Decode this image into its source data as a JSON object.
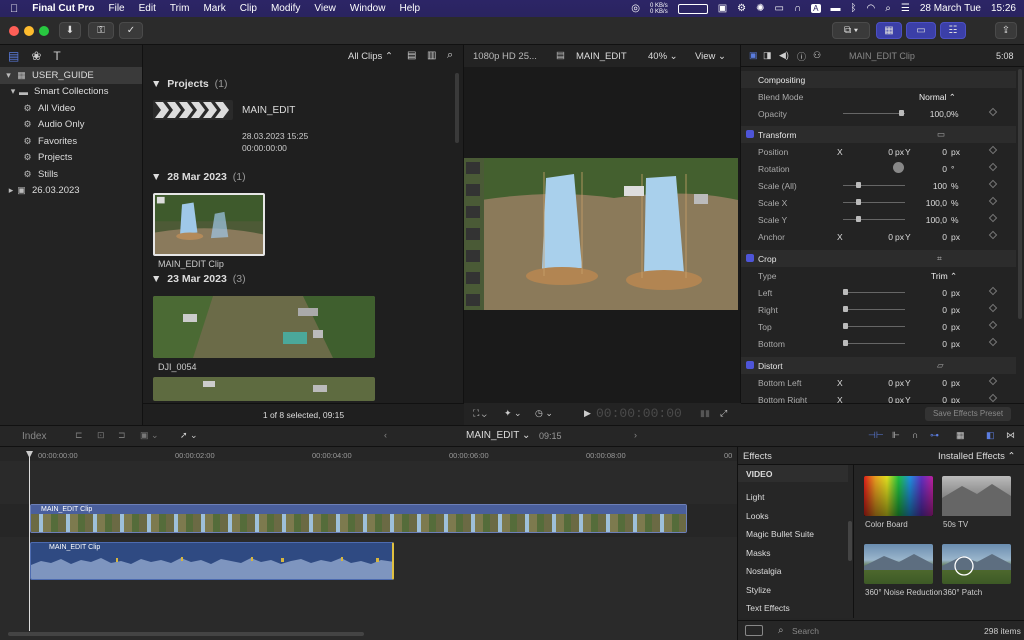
{
  "menubar": {
    "apple": "",
    "app": "Final Cut Pro",
    "items": [
      "File",
      "Edit",
      "Trim",
      "Mark",
      "Clip",
      "Modify",
      "View",
      "Window",
      "Help"
    ],
    "net_up": "0 KB/s",
    "net_down": "0 KB/s",
    "date": "28 March Tue",
    "time": "15:26"
  },
  "library": {
    "name": "USER_GUIDE",
    "items": [
      {
        "label": "Smart Collections",
        "icon": "folder-icon"
      },
      {
        "label": "All Video",
        "icon": "gear-icon"
      },
      {
        "label": "Audio Only",
        "icon": "gear-icon"
      },
      {
        "label": "Favorites",
        "icon": "gear-icon"
      },
      {
        "label": "Projects",
        "icon": "gear-icon"
      },
      {
        "label": "Stills",
        "icon": "gear-icon"
      },
      {
        "label": "26.03.2023",
        "icon": "event-icon"
      }
    ]
  },
  "browser": {
    "filter": "All Clips",
    "sections": [
      {
        "title": "Projects",
        "count": "(1)"
      },
      {
        "title": "28 Mar 2023",
        "count": "(1)"
      },
      {
        "title": "23 Mar 2023",
        "count": "(3)"
      }
    ],
    "project": {
      "name": "MAIN_EDIT",
      "date": "28.03.2023 15:25",
      "duration": "00:00:00:00"
    },
    "clip1": "MAIN_EDIT Clip",
    "clip2": "DJI_0054",
    "footer": "1 of 8 selected, 09:15"
  },
  "viewer": {
    "format": "1080p HD 25...",
    "title": "MAIN_EDIT",
    "zoom": "40%",
    "view": "View",
    "timecode": "00:00:00:00"
  },
  "inspector": {
    "title": "MAIN_EDIT Clip",
    "timecode": "5:08",
    "compositing": "Compositing",
    "blend_label": "Blend Mode",
    "blend_value": "Normal",
    "opacity_label": "Opacity",
    "opacity_value": "100,0",
    "pct": "%",
    "transform": "Transform",
    "position": "Position",
    "rotation": "Rotation",
    "scale_all": "Scale (All)",
    "scale_x": "Scale X",
    "scale_y": "Scale Y",
    "anchor": "Anchor",
    "x": "X",
    "y": "Y",
    "zero": "0",
    "px": "px",
    "deg": "°",
    "v100": "100",
    "v1000": "100,0",
    "crop": "Crop",
    "type": "Type",
    "trim": "Trim",
    "left": "Left",
    "right": "Right",
    "top": "Top",
    "bottom": "Bottom",
    "distort": "Distort",
    "bottom_left": "Bottom Left",
    "bottom_right": "Bottom Right",
    "save_preset": "Save Effects Preset"
  },
  "timeline": {
    "index": "Index",
    "project": "MAIN_EDIT",
    "duration": "09:15",
    "ticks": [
      "00:00:00:00",
      "00:00:02:00",
      "00:00:04:00",
      "00:00:06:00",
      "00:00:08:00",
      "00"
    ],
    "video_clip": "MAIN_EDIT Clip",
    "audio_clip": "MAIN_EDIT Clip"
  },
  "effects": {
    "title": "Effects",
    "installed": "Installed Effects",
    "category_header": "VIDEO",
    "categories": [
      "Light",
      "Looks",
      "Magic Bullet Suite",
      "Masks",
      "Nostalgia",
      "Stylize",
      "Text Effects"
    ],
    "thumbs": [
      "Color Board",
      "50s TV",
      "360° Noise Reduction",
      "360° Patch"
    ],
    "search_placeholder": "Search",
    "count": "298 items"
  }
}
